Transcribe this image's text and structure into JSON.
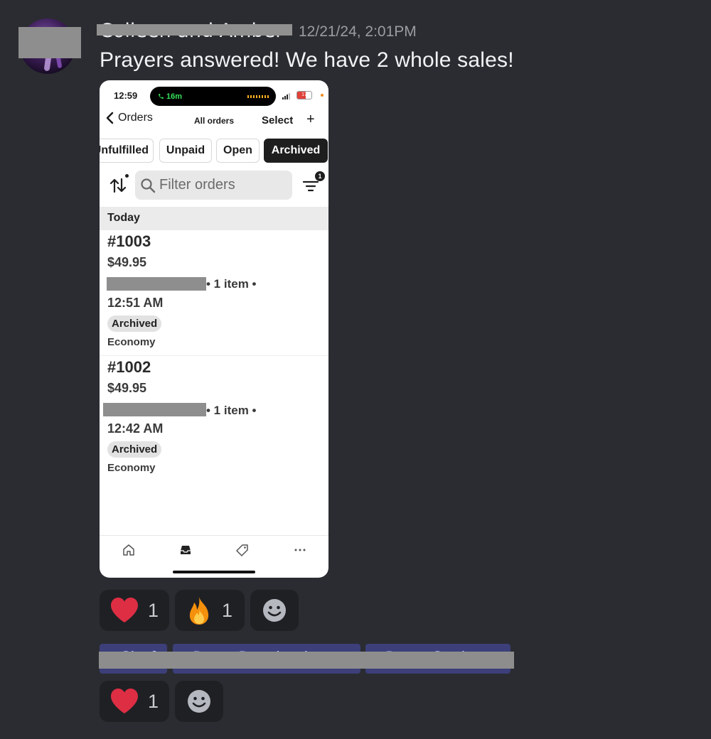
{
  "message": {
    "author": "Colleen and Amber",
    "timestamp": "12/21/24, 2:01PM",
    "text": "Prayers answered! We have 2 whole sales!"
  },
  "phone": {
    "status": {
      "time": "12:59",
      "call": "16m",
      "battery": "17"
    },
    "nav": {
      "back_label": "Orders",
      "title": "All orders",
      "select_label": "Select",
      "add_label": "+"
    },
    "filter_chips": [
      {
        "label": "Unfulfilled",
        "active": false
      },
      {
        "label": "Unpaid",
        "active": false
      },
      {
        "label": "Open",
        "active": false
      },
      {
        "label": "Archived",
        "active": true
      }
    ],
    "search": {
      "placeholder": "Filter orders"
    },
    "filter_badge": "1",
    "section": "Today",
    "orders": [
      {
        "number": "#1003",
        "price": "$49.95",
        "items": "• 1 item •",
        "time": "12:51 AM",
        "status": "Archived",
        "shipping": "Economy"
      },
      {
        "number": "#1002",
        "price": "$49.95",
        "items": "• 1 item •",
        "time": "12:42 AM",
        "status": "Archived",
        "shipping": "Economy"
      }
    ],
    "tabs": [
      "home",
      "orders",
      "products",
      "more"
    ]
  },
  "reactions_row1": [
    {
      "emoji": "heart",
      "count": "1",
      "color": "#dd2e44"
    },
    {
      "emoji": "fire",
      "count": "1",
      "color": "#f4900c"
    }
  ],
  "mentions": [
    "@Chef",
    "@Peter Rosebush",
    "@Peter Cook"
  ],
  "reactions_row2": [
    {
      "emoji": "heart",
      "count": "1",
      "color": "#dd2e44"
    }
  ]
}
